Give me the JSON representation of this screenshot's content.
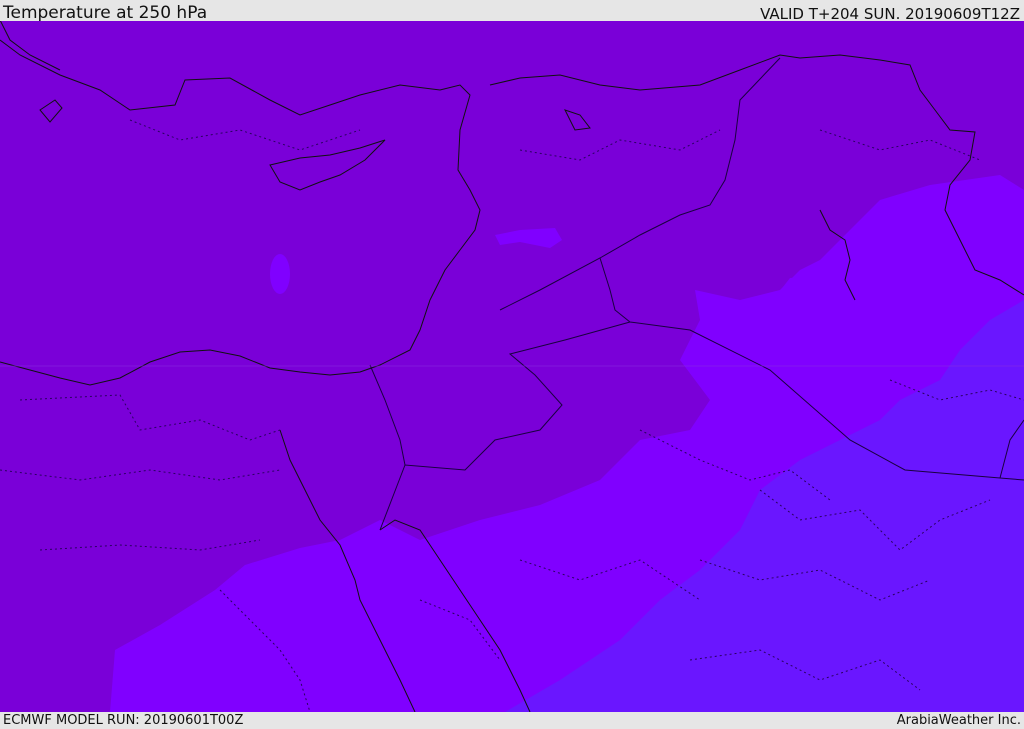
{
  "header": {
    "title": "Temperature at 250 hPa",
    "valid": "VALID T+204 SUN. 20190609T12Z"
  },
  "footer": {
    "model_run": "ECMWF MODEL RUN: 20190601T00Z",
    "credit": "ArabiaWeather Inc."
  },
  "map": {
    "colors": {
      "field_warm": "#7a00d8",
      "field_mid": "#8000ff",
      "field_cool": "#6a16ff",
      "coastline": "#111111",
      "border": "#1a0040"
    }
  }
}
